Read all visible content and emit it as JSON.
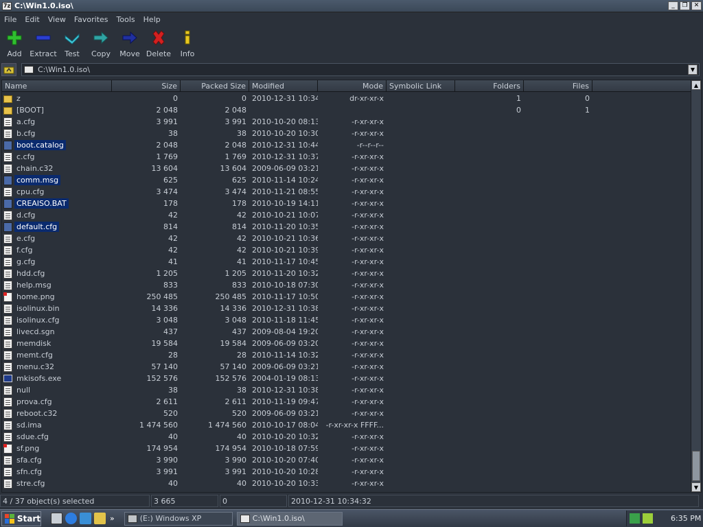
{
  "window": {
    "title": "C:\\Win1.0.iso\\",
    "app_icon": "7z"
  },
  "menu": [
    "File",
    "Edit",
    "View",
    "Favorites",
    "Tools",
    "Help"
  ],
  "toolbar": [
    {
      "label": "Add",
      "icon": "plus-icon",
      "color": "#2fbf2f"
    },
    {
      "label": "Extract",
      "icon": "minus-icon",
      "color": "#2a3fd0"
    },
    {
      "label": "Test",
      "icon": "check-icon",
      "color": "#40c8d8"
    },
    {
      "label": "Copy",
      "icon": "arrow-right-icon",
      "color": "#2fa4a4"
    },
    {
      "label": "Move",
      "icon": "arrow-right-icon",
      "color": "#2030a0"
    },
    {
      "label": "Delete",
      "icon": "x-icon",
      "color": "#d42020"
    },
    {
      "label": "Info",
      "icon": "info-icon",
      "color": "#e8c820"
    }
  ],
  "address": {
    "path": "C:\\Win1.0.iso\\"
  },
  "columns": {
    "name": "Name",
    "size": "Size",
    "packed": "Packed Size",
    "modified": "Modified",
    "mode": "Mode",
    "symlink": "Symbolic Link",
    "folders": "Folders",
    "files": "Files"
  },
  "rows": [
    {
      "name": "z",
      "type": "folder",
      "size": "0",
      "packed": "0",
      "modified": "2010-12-31 10:34",
      "mode": "dr-xr-xr-x",
      "folders": "1",
      "files": "0",
      "selected": false
    },
    {
      "name": "[BOOT]",
      "type": "folder",
      "size": "2 048",
      "packed": "2 048",
      "modified": "",
      "mode": "",
      "folders": "0",
      "files": "1",
      "selected": false
    },
    {
      "name": "a.cfg",
      "type": "file",
      "size": "3 991",
      "packed": "3 991",
      "modified": "2010-10-20 08:13",
      "mode": "-r-xr-xr-x",
      "selected": false
    },
    {
      "name": "b.cfg",
      "type": "file",
      "size": "38",
      "packed": "38",
      "modified": "2010-10-20 10:30",
      "mode": "-r-xr-xr-x",
      "selected": false
    },
    {
      "name": "boot.catalog",
      "type": "sys",
      "size": "2 048",
      "packed": "2 048",
      "modified": "2010-12-31 10:44",
      "mode": "-r--r--r--",
      "selected": true
    },
    {
      "name": "c.cfg",
      "type": "file",
      "size": "1 769",
      "packed": "1 769",
      "modified": "2010-12-31 10:37",
      "mode": "-r-xr-xr-x",
      "selected": false
    },
    {
      "name": "chain.c32",
      "type": "file",
      "size": "13 604",
      "packed": "13 604",
      "modified": "2009-06-09 03:21",
      "mode": "-r-xr-xr-x",
      "selected": false
    },
    {
      "name": "comm.msg",
      "type": "sys",
      "size": "625",
      "packed": "625",
      "modified": "2010-11-14 10:24",
      "mode": "-r-xr-xr-x",
      "selected": true
    },
    {
      "name": "cpu.cfg",
      "type": "file",
      "size": "3 474",
      "packed": "3 474",
      "modified": "2010-11-21 08:55",
      "mode": "-r-xr-xr-x",
      "selected": false
    },
    {
      "name": "CREAISO.BAT",
      "type": "sys",
      "size": "178",
      "packed": "178",
      "modified": "2010-10-19 14:11",
      "mode": "-r-xr-xr-x",
      "selected": true
    },
    {
      "name": "d.cfg",
      "type": "file",
      "size": "42",
      "packed": "42",
      "modified": "2010-10-21 10:07",
      "mode": "-r-xr-xr-x",
      "selected": false
    },
    {
      "name": "default.cfg",
      "type": "sys",
      "size": "814",
      "packed": "814",
      "modified": "2010-11-20 10:35",
      "mode": "-r-xr-xr-x",
      "selected": true
    },
    {
      "name": "e.cfg",
      "type": "file",
      "size": "42",
      "packed": "42",
      "modified": "2010-10-21 10:36",
      "mode": "-r-xr-xr-x",
      "selected": false
    },
    {
      "name": "f.cfg",
      "type": "file",
      "size": "42",
      "packed": "42",
      "modified": "2010-10-21 10:39",
      "mode": "-r-xr-xr-x",
      "selected": false
    },
    {
      "name": "g.cfg",
      "type": "file",
      "size": "41",
      "packed": "41",
      "modified": "2010-11-17 10:45",
      "mode": "-r-xr-xr-x",
      "selected": false
    },
    {
      "name": "hdd.cfg",
      "type": "file",
      "size": "1 205",
      "packed": "1 205",
      "modified": "2010-11-20 10:32",
      "mode": "-r-xr-xr-x",
      "selected": false
    },
    {
      "name": "help.msg",
      "type": "file",
      "size": "833",
      "packed": "833",
      "modified": "2010-10-18 07:30",
      "mode": "-r-xr-xr-x",
      "selected": false
    },
    {
      "name": "home.png",
      "type": "img",
      "size": "250 485",
      "packed": "250 485",
      "modified": "2010-11-17 10:50",
      "mode": "-r-xr-xr-x",
      "selected": false
    },
    {
      "name": "isolinux.bin",
      "type": "file",
      "size": "14 336",
      "packed": "14 336",
      "modified": "2010-12-31 10:38",
      "mode": "-r-xr-xr-x",
      "selected": false
    },
    {
      "name": "isolinux.cfg",
      "type": "file",
      "size": "3 048",
      "packed": "3 048",
      "modified": "2010-11-18 11:45",
      "mode": "-r-xr-xr-x",
      "selected": false
    },
    {
      "name": "livecd.sgn",
      "type": "file",
      "size": "437",
      "packed": "437",
      "modified": "2009-08-04 19:20",
      "mode": "-r-xr-xr-x",
      "selected": false
    },
    {
      "name": "memdisk",
      "type": "file",
      "size": "19 584",
      "packed": "19 584",
      "modified": "2009-06-09 03:20",
      "mode": "-r-xr-xr-x",
      "selected": false
    },
    {
      "name": "memt.cfg",
      "type": "file",
      "size": "28",
      "packed": "28",
      "modified": "2010-11-14 10:32",
      "mode": "-r-xr-xr-x",
      "selected": false
    },
    {
      "name": "menu.c32",
      "type": "file",
      "size": "57 140",
      "packed": "57 140",
      "modified": "2009-06-09 03:21",
      "mode": "-r-xr-xr-x",
      "selected": false
    },
    {
      "name": "mkisofs.exe",
      "type": "exe",
      "size": "152 576",
      "packed": "152 576",
      "modified": "2004-01-19 08:13",
      "mode": "-r-xr-xr-x",
      "selected": false
    },
    {
      "name": "null",
      "type": "file",
      "size": "38",
      "packed": "38",
      "modified": "2010-12-31 10:38",
      "mode": "-r-xr-xr-x",
      "selected": false
    },
    {
      "name": "prova.cfg",
      "type": "file",
      "size": "2 611",
      "packed": "2 611",
      "modified": "2010-11-19 09:47",
      "mode": "-r-xr-xr-x",
      "selected": false
    },
    {
      "name": "reboot.c32",
      "type": "file",
      "size": "520",
      "packed": "520",
      "modified": "2009-06-09 03:21",
      "mode": "-r-xr-xr-x",
      "selected": false
    },
    {
      "name": "sd.ima",
      "type": "file",
      "size": "1 474 560",
      "packed": "1 474 560",
      "modified": "2010-10-17 08:04",
      "mode": "-r-xr-xr-x FFFF...",
      "selected": false
    },
    {
      "name": "sdue.cfg",
      "type": "file",
      "size": "40",
      "packed": "40",
      "modified": "2010-10-20 10:32",
      "mode": "-r-xr-xr-x",
      "selected": false
    },
    {
      "name": "sf.png",
      "type": "img",
      "size": "174 954",
      "packed": "174 954",
      "modified": "2010-10-18 07:59",
      "mode": "-r-xr-xr-x",
      "selected": false
    },
    {
      "name": "sfa.cfg",
      "type": "file",
      "size": "3 990",
      "packed": "3 990",
      "modified": "2010-10-20 07:40",
      "mode": "-r-xr-xr-x",
      "selected": false
    },
    {
      "name": "sfn.cfg",
      "type": "file",
      "size": "3 991",
      "packed": "3 991",
      "modified": "2010-10-20 10:28",
      "mode": "-r-xr-xr-x",
      "selected": false
    },
    {
      "name": "stre.cfg",
      "type": "file",
      "size": "40",
      "packed": "40",
      "modified": "2010-10-20 10:33",
      "mode": "-r-xr-xr-x",
      "selected": false
    }
  ],
  "status": {
    "selection": "4 / 37 object(s) selected",
    "size": "3 665",
    "packed": "0",
    "modified": "2010-12-31 10:34:32"
  },
  "taskbar": {
    "start": "Start",
    "tasks": [
      {
        "label": "(E:) Windows XP",
        "active": false
      },
      {
        "label": "C:\\Win1.0.iso\\",
        "active": true
      }
    ],
    "clock": "6:35 PM"
  }
}
